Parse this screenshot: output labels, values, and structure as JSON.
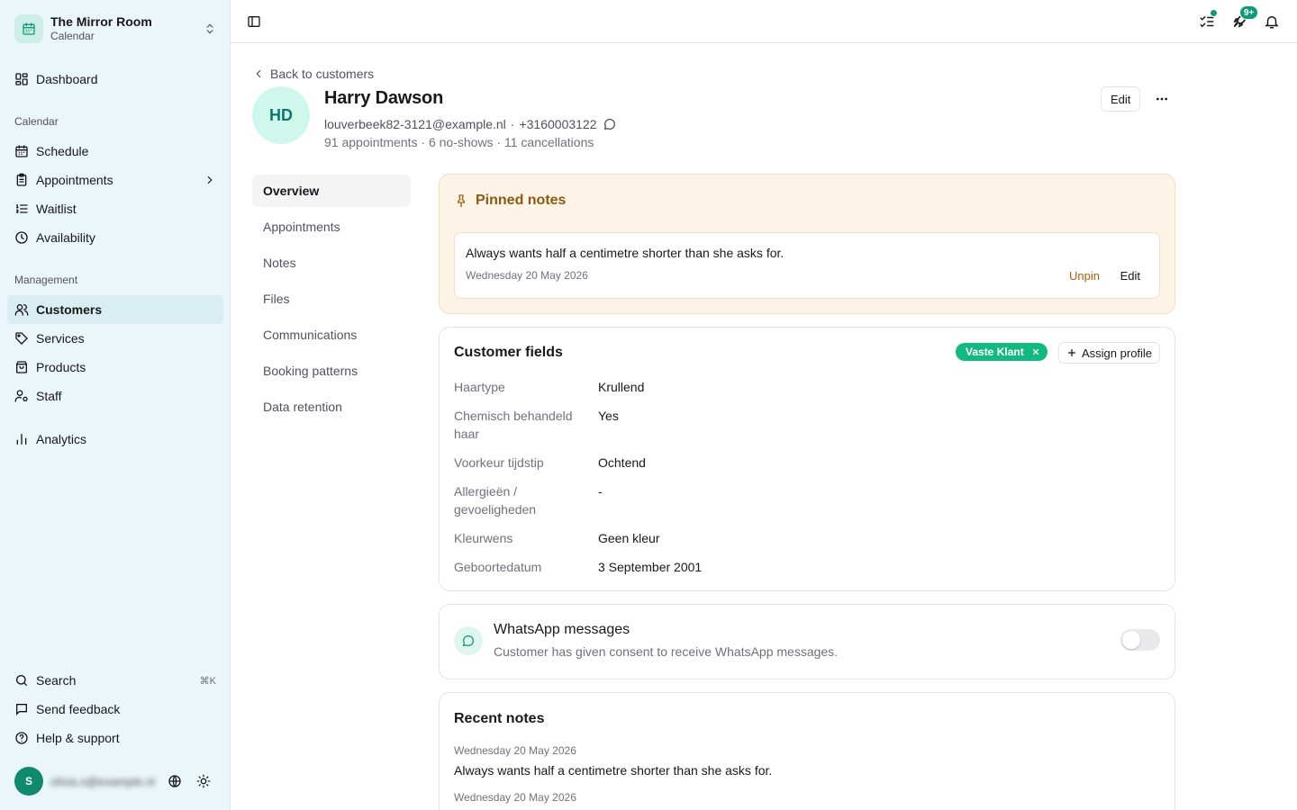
{
  "workspace": {
    "name": "The Mirror Room",
    "subtitle": "Calendar"
  },
  "sidebar": {
    "dashboard": "Dashboard",
    "section_calendar": "Calendar",
    "calendar_items": [
      "Schedule",
      "Appointments",
      "Waitlist",
      "Availability"
    ],
    "section_management": "Management",
    "management_items": [
      "Customers",
      "Services",
      "Products",
      "Staff"
    ],
    "analytics": "Analytics",
    "search": "Search",
    "search_shortcut": "⌘K",
    "feedback": "Send feedback",
    "help": "Help & support",
    "user_initial": "S",
    "user_email": "olivia.s@example.nl",
    "active_item": "Customers"
  },
  "topbar": {
    "notifications_count": "9+"
  },
  "customer": {
    "back_label": "Back to customers",
    "initials": "HD",
    "name": "Harry Dawson",
    "email": "louverbeek82-3121@example.nl",
    "separator": "·",
    "phone": "+3160003122",
    "stats": "91 appointments · 6 no-shows · 11 cancellations",
    "edit_label": "Edit"
  },
  "subnav": [
    "Overview",
    "Appointments",
    "Notes",
    "Files",
    "Communications",
    "Booking patterns",
    "Data retention"
  ],
  "pinned": {
    "title": "Pinned notes",
    "note_text": "Always wants half a centimetre shorter than she asks for.",
    "note_date": "Wednesday 20 May 2026",
    "unpin": "Unpin",
    "edit": "Edit",
    "bg_color": "#fdf3e6",
    "accent_color": "#a16207"
  },
  "fields": {
    "title": "Customer fields",
    "profile_chip": "Vaste Klant",
    "assign_profile": "Assign profile",
    "rows": [
      {
        "label": "Haartype",
        "value": "Krullend"
      },
      {
        "label": "Chemisch behandeld haar",
        "value": "Yes"
      },
      {
        "label": "Voorkeur tijdstip",
        "value": "Ochtend"
      },
      {
        "label": "Allergieën / gevoeligheden",
        "value": "-"
      },
      {
        "label": "Kleurwens",
        "value": "Geen kleur"
      },
      {
        "label": "Geboortedatum",
        "value": "3 September 2001"
      }
    ]
  },
  "whatsapp": {
    "title": "WhatsApp messages",
    "description": "Customer has given consent to receive WhatsApp messages.",
    "enabled": false
  },
  "recent_notes": {
    "title": "Recent notes",
    "items": [
      {
        "date": "Wednesday 20 May 2026",
        "text": "Always wants half a centimetre shorter than she asks for."
      },
      {
        "date": "Wednesday 20 May 2026",
        "text": ""
      }
    ]
  },
  "colors": {
    "brand": "#0f9b7a",
    "chip": "#12b981",
    "sidebar_bg": "#eaf6f9"
  }
}
